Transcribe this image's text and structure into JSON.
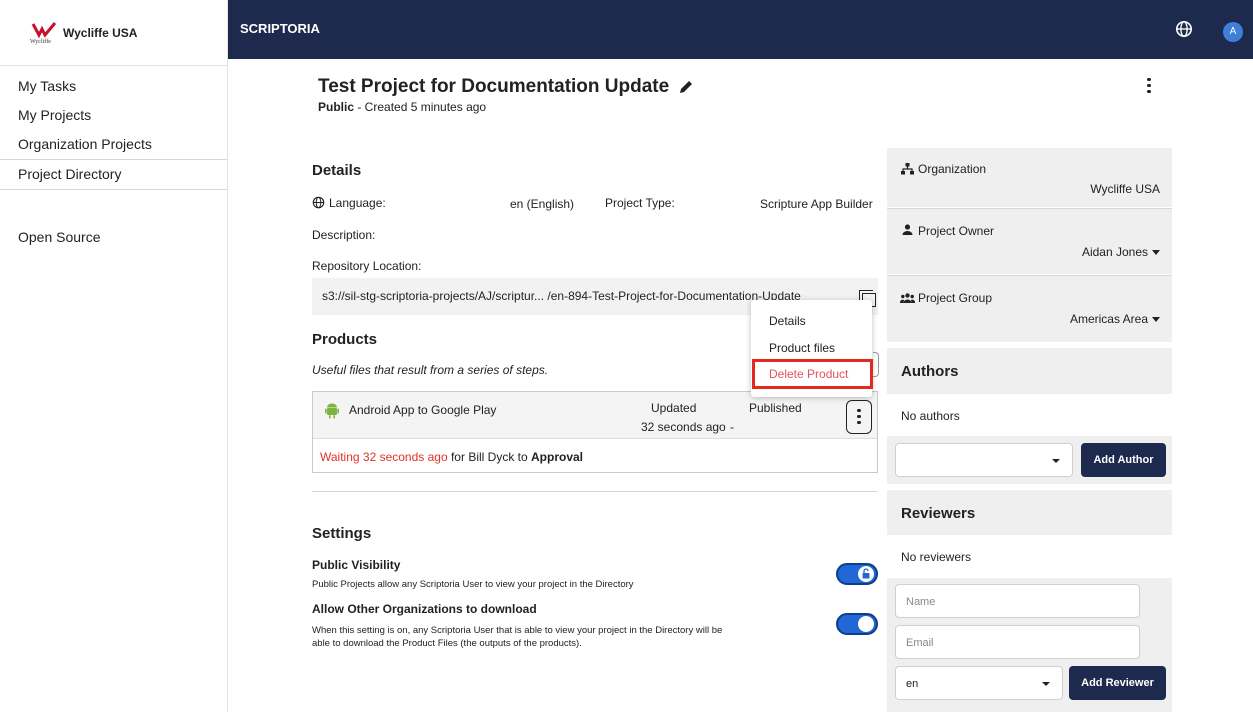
{
  "org_brand": {
    "name": "Wycliffe USA",
    "logo_text": "Wycliffe"
  },
  "sidebar": {
    "items": [
      {
        "label": "My Tasks"
      },
      {
        "label": "My Projects"
      },
      {
        "label": "Organization Projects"
      },
      {
        "label": "Project Directory"
      },
      {
        "label": "Open Source"
      }
    ]
  },
  "topbar": {
    "app_name": "SCRIPTORIA",
    "avatar_initial": "A"
  },
  "project": {
    "title": "Test Project for Documentation Update",
    "visibility": "Public",
    "created": " - Created 5 minutes ago"
  },
  "details": {
    "heading": "Details",
    "language_label": "Language:",
    "language_value": "en (English)",
    "project_type_label": "Project Type:",
    "project_type_value": "Scripture App Builder",
    "description_label": "Description:",
    "repository_label": "Repository Location:",
    "repository_value": "s3://sil-stg-scriptoria-projects/AJ/scriptur... /en-894-Test-Project-for-Documentation-Update"
  },
  "products": {
    "heading": "Products",
    "subtitle": "Useful files that result from a series of steps.",
    "items": [
      {
        "name": "Android App to Google Play",
        "updated_label": "Updated",
        "updated_value": "32 seconds ago",
        "published_label": "Published",
        "published_value": "-",
        "waiting_text": "Waiting 32 seconds ago",
        "waiting_for": " for Bill Dyck to ",
        "waiting_step": "Approval"
      }
    ],
    "menu": {
      "details": "Details",
      "product_files": "Product files",
      "delete": "Delete Product"
    }
  },
  "settings": {
    "heading": "Settings",
    "public_title": "Public Visibility",
    "public_desc": "Public Projects allow any Scriptoria User to view your project in the Directory",
    "public_on": true,
    "download_title": "Allow Other Organizations to download",
    "download_desc_1": "When this setting is on, any Scriptoria User that is able to view your project in the Directory will be",
    "download_desc_2": "able to download the Product Files (the outputs of the products).",
    "download_on": true
  },
  "side_panel": {
    "organization_label": "Organization",
    "organization_value": "Wycliffe USA",
    "owner_label": "Project Owner",
    "owner_value": "Aidan Jones",
    "group_label": "Project Group",
    "group_value": "Americas Area",
    "authors_heading": "Authors",
    "no_authors": "No authors",
    "add_author": "Add Author",
    "reviewers_heading": "Reviewers",
    "no_reviewers": "No reviewers",
    "name_placeholder": "Name",
    "email_placeholder": "Email",
    "locale_value": "en",
    "add_reviewer": "Add Reviewer"
  },
  "colors": {
    "navy": "#1d2a4d",
    "accent_blue": "#2167d6",
    "danger": "#e12a20"
  }
}
